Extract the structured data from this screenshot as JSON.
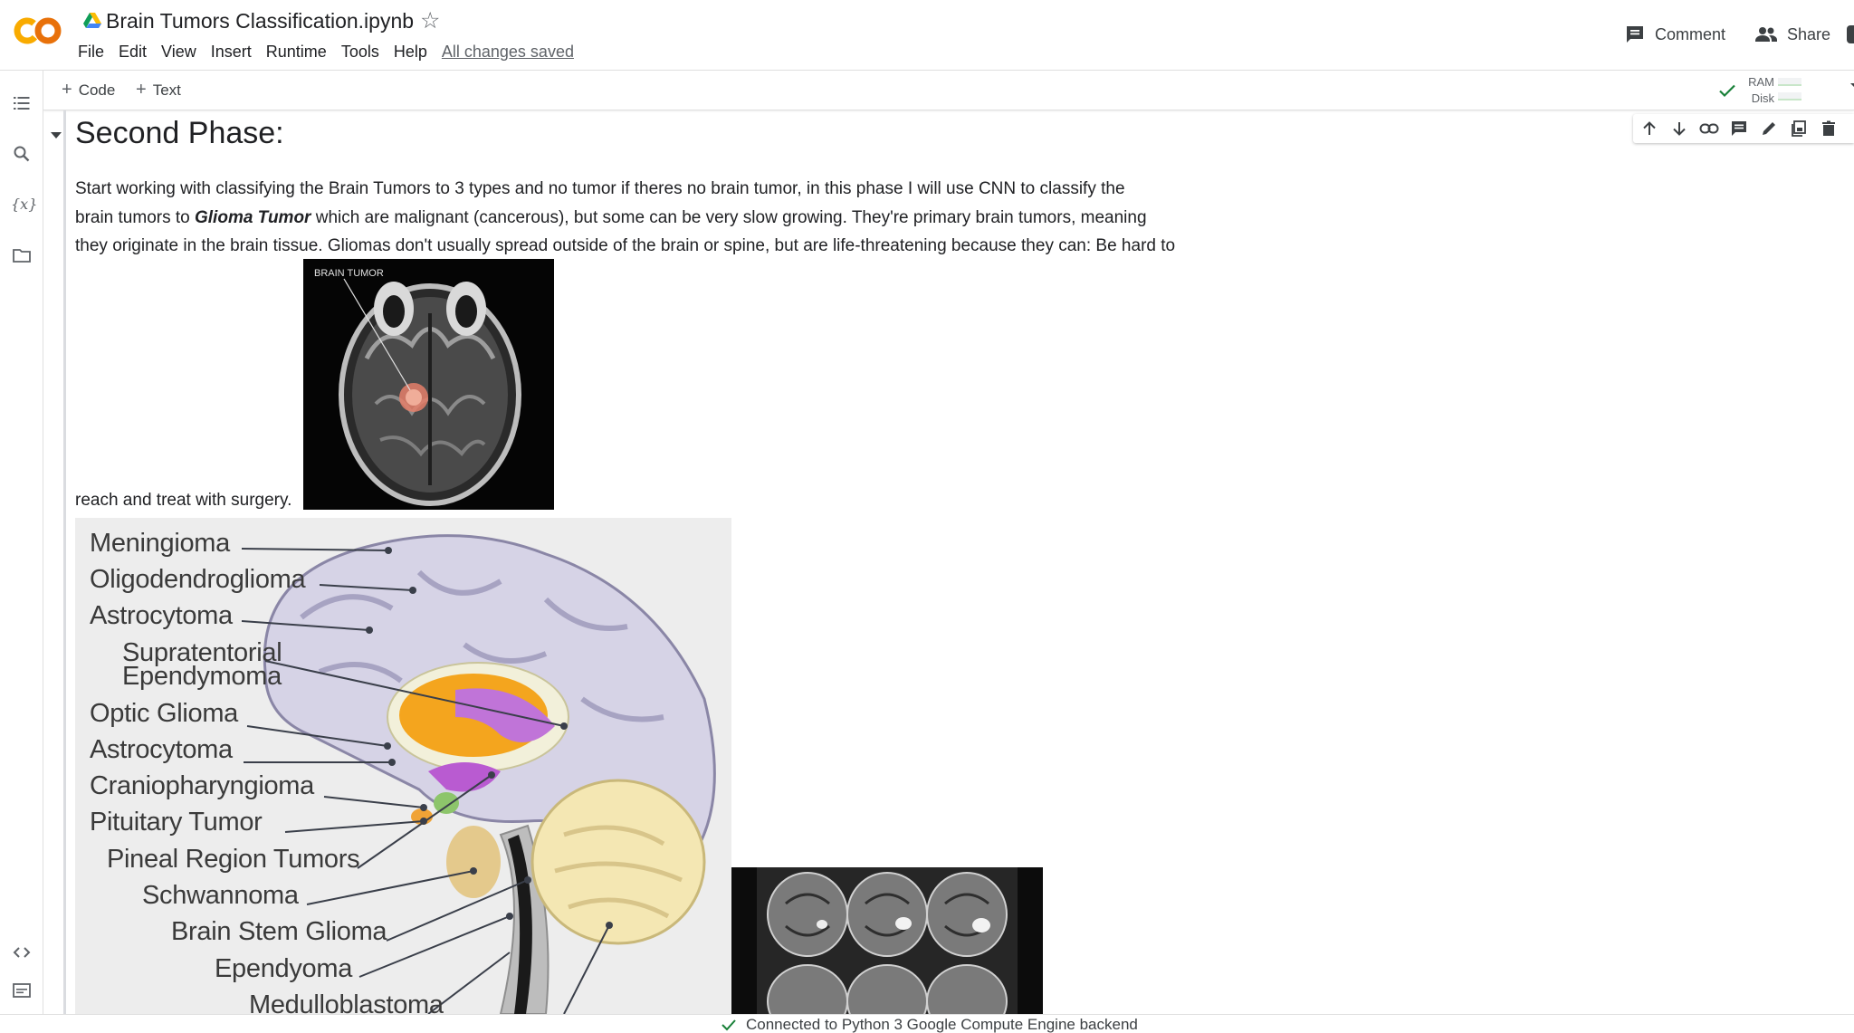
{
  "header": {
    "title": "Brain Tumors Classification.ipynb",
    "logo_text": "CO",
    "menu": [
      "File",
      "Edit",
      "View",
      "Insert",
      "Runtime",
      "Tools",
      "Help"
    ],
    "save_status": "All changes saved",
    "comment_label": "Comment",
    "share_label": "Share"
  },
  "toolbar": {
    "add_code_label": "Code",
    "add_text_label": "Text",
    "ram_label": "RAM",
    "disk_label": "Disk"
  },
  "sidebar": {
    "icons": [
      "toc-icon",
      "search-icon",
      "variables-icon",
      "folder-icon",
      "code-snippets-icon",
      "terminal-icon"
    ],
    "variables_glyph": "{x}"
  },
  "cell": {
    "heading": "Second Phase:",
    "para_line1": "Start working with classifying the Brain Tumors to 3 types and no tumor if theres no brain tumor, in this phase I will use CNN to classify the",
    "para_line2_a": "brain tumors to ",
    "para_line2_bold": "Glioma Tumor",
    "para_line2_b": " which are malignant (cancerous), but some can be very slow growing. They're primary brain tumors, meaning",
    "para_line3": "they originate in the brain tissue. Gliomas don't usually spread outside of the brain or spine, but are life-threatening because they can: Be hard to",
    "para_line4": "reach and treat with surgery.",
    "toolbar_icons": [
      "move-up-icon",
      "move-down-icon",
      "link-icon",
      "comment-icon",
      "edit-icon",
      "mirror-cell-icon",
      "delete-icon"
    ]
  },
  "images": {
    "mri_label": "BRAIN TUMOR",
    "brain_labels": [
      "Meningioma",
      "Oligodendroglioma",
      "Astrocytoma",
      "Supratentorial",
      "Ependymoma",
      "Optic Glioma",
      "Astrocytoma",
      "Craniopharyngioma",
      "Pituitary Tumor",
      "Pineal Region Tumors",
      "Schwannoma",
      "Brain Stem Glioma",
      "Ependyoma",
      "Medulloblastoma"
    ]
  },
  "status": {
    "text": "Connected to Python 3 Google Compute Engine backend"
  },
  "colors": {
    "logo_orange": "#f9ab00",
    "logo_orange_dark": "#e8710a",
    "check_green": "#188038"
  }
}
